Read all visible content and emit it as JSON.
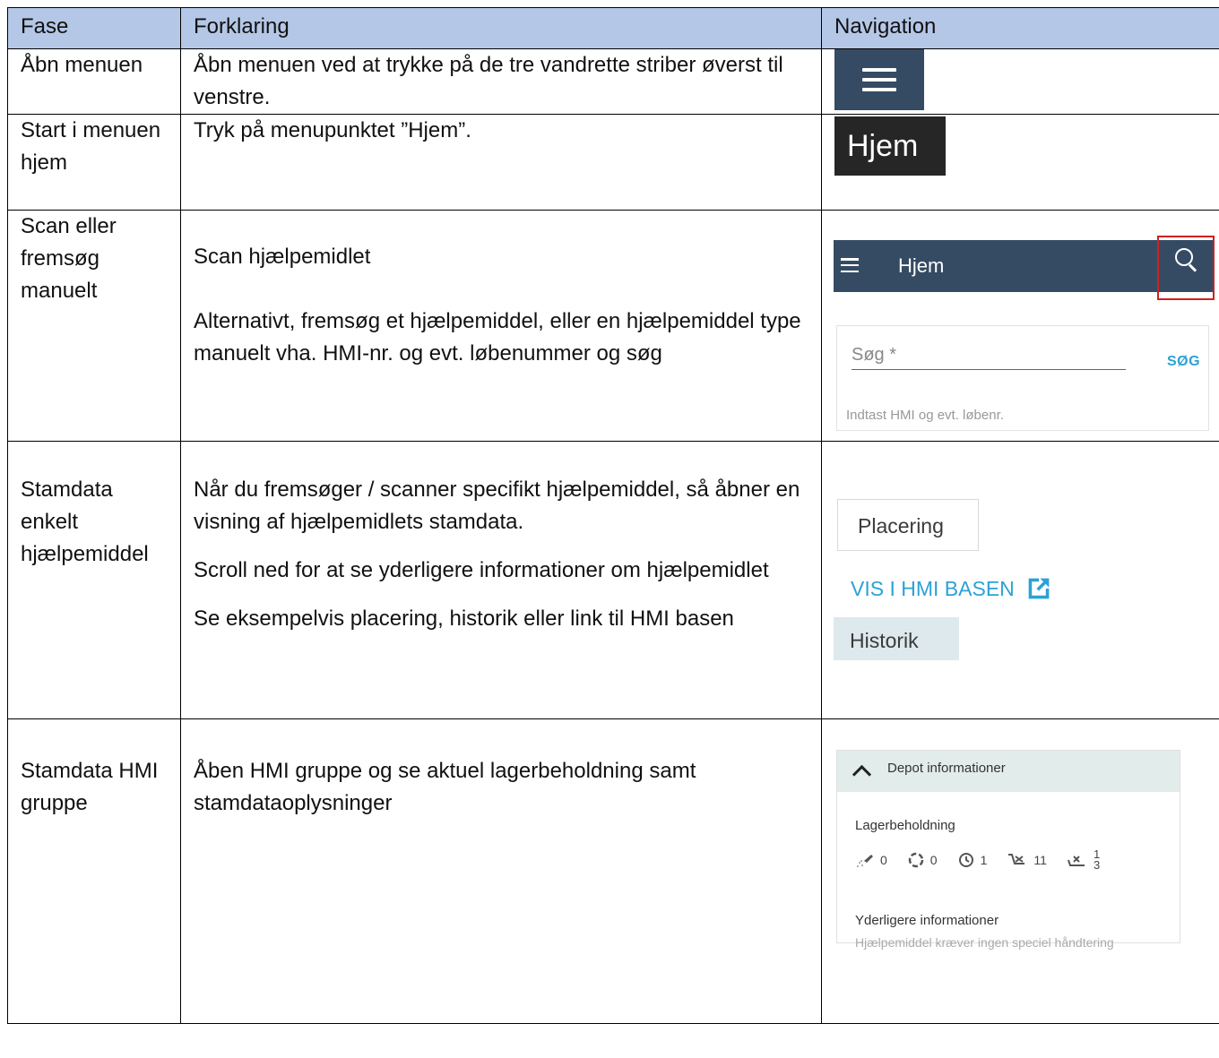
{
  "headers": {
    "fase": "Fase",
    "forklaring": "Forklaring",
    "navigation": "Navigation"
  },
  "rows": [
    {
      "fase": "Åbn menuen",
      "forklaring": [
        "Åbn menuen ved at trykke på de tre vandrette striber øverst til venstre."
      ],
      "nav": {
        "icon": "hamburger-menu-icon",
        "bg": "#354b63"
      }
    },
    {
      "fase": "Start i menuen hjem",
      "forklaring": [
        "Tryk på menupunktet ”Hjem”."
      ],
      "nav": {
        "label": "Hjem",
        "bg": "#262626"
      }
    },
    {
      "fase": "Scan eller fremsøg manuelt",
      "forklaring": [
        "Scan hjælpemidlet",
        "Alternativt,  fremsøg et hjælpemiddel, eller en hjælpemiddel type manuelt vha. HMI-nr. og evt. løbenummer og søg"
      ],
      "nav": {
        "appbar_title": "Hjem",
        "search_placeholder": "Søg *",
        "search_button": "SØG",
        "search_hint": "Indtast HMI og evt. løbenr.",
        "highlight_color": "#d02020"
      }
    },
    {
      "fase": "Stamdata enkelt hjælpemiddel",
      "forklaring": [
        "Når du fremsøger / scanner specifikt hjælpemiddel, så åbner en visning af hjælpemidlets stamdata.",
        "Scroll ned for at se yderligere informationer om hjælpemidlet",
        "Se eksempelvis placering, historik eller link til HMI basen"
      ],
      "nav": {
        "placering": "Placering",
        "vis_link": "VIS I HMI BASEN",
        "historik": "Historik",
        "link_color": "#2ca2d6"
      }
    },
    {
      "fase": "Stamdata HMI gruppe",
      "forklaring": [
        "Åben HMI gruppe og se aktuel lagerbeholdning samt stamdataoplysninger"
      ],
      "nav": {
        "section_title": "Depot informationer",
        "lager_label": "Lagerbeholdning",
        "counts": [
          {
            "icon": "cleaning-icon",
            "value": "0"
          },
          {
            "icon": "in-repair-icon",
            "value": "0"
          },
          {
            "icon": "reserved-clock-icon",
            "value": "1"
          },
          {
            "icon": "available-cart-icon",
            "value": "11"
          },
          {
            "icon": "blocked-cart-icon",
            "value": "1",
            "sub": "3"
          }
        ],
        "more_label": "Yderligere informationer",
        "more_text": "Hjælpemiddel kræver ingen speciel håndtering"
      }
    }
  ]
}
